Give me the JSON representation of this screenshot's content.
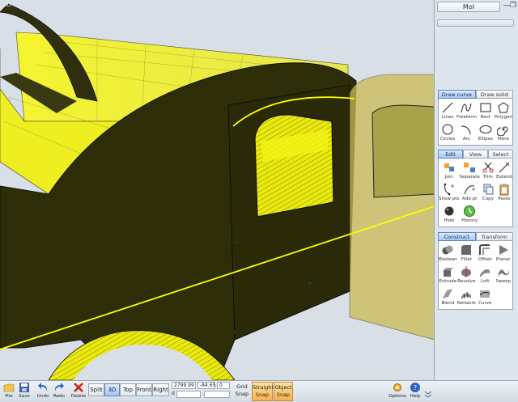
{
  "app": {
    "logo": "MoI",
    "viewport_label": "3D",
    "colors": {
      "accent": "#5b86c2",
      "model_yellow": "#ffff00",
      "model_dark": "#2d2d08",
      "snap_on": "#f4b34d"
    }
  },
  "window_buttons": [
    {
      "name": "minimize-icon",
      "glyph": "—"
    },
    {
      "name": "restore-icon",
      "glyph": "❐"
    },
    {
      "name": "close-icon",
      "glyph": "✕"
    }
  ],
  "draw": {
    "tabs": [
      {
        "label": "Draw curve",
        "active": true
      },
      {
        "label": "Draw solid",
        "active": false
      }
    ],
    "tools": [
      "Lines",
      "Freeform",
      "Rect",
      "Polygon",
      "Circles",
      "Arc",
      "Ellipse",
      "More"
    ]
  },
  "edit": {
    "tabs": [
      {
        "label": "Edit",
        "active": true
      },
      {
        "label": "View",
        "active": false
      },
      {
        "label": "Select",
        "active": false
      }
    ],
    "tools": [
      "Join",
      "Separate",
      "Trim",
      "Extend",
      "Show pts",
      "Add pt",
      "Copy",
      "Paste",
      "Hide",
      "History"
    ]
  },
  "construct": {
    "tabs": [
      {
        "label": "Construct",
        "active": true
      },
      {
        "label": "Transform",
        "active": false
      }
    ],
    "tools": [
      "Boolean",
      "Fillet",
      "Offset",
      "Planar",
      "Extrude",
      "Revolve",
      "Loft",
      "Sweep",
      "Blend",
      "Network",
      "Curve"
    ]
  },
  "toolbar": {
    "file": "File",
    "save": "Save",
    "undo": "Undo",
    "redo": "Redo",
    "delete": "Delete",
    "views": [
      "Split",
      "3D",
      "Top",
      "Front",
      "Right"
    ],
    "active_view": "3D",
    "coords": {
      "x": "2799.99",
      "y": "-84.65",
      "z": "0",
      "d_prefix": "d"
    },
    "grid_snap": [
      "Grid",
      "Snap"
    ],
    "straight_snap": [
      "Straight",
      "Snap"
    ],
    "object_snap": [
      "Object",
      "Snap"
    ],
    "options": "Options",
    "help": "Help"
  }
}
